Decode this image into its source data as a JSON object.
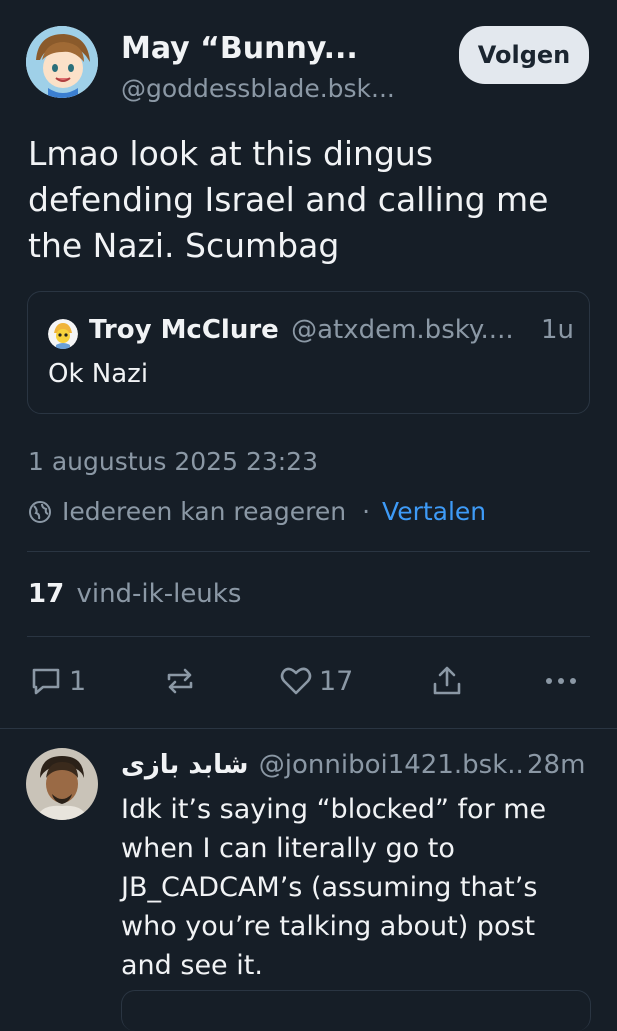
{
  "post": {
    "author_name": "May “Bunny...",
    "author_handle": "@goddessblade.bsk...",
    "follow_label": "Volgen",
    "text": "Lmao look at this dingus defending Israel and calling me the Nazi. Scumbag",
    "quote": {
      "author_name": "Troy McClure",
      "author_handle": "@atxdem.bsky....",
      "time": "1u",
      "text": "Ok Nazi"
    },
    "timestamp": "1 augustus 2025 23:23",
    "reply_setting": "Iedereen kan reageren",
    "separator": "·",
    "translate_label": "Vertalen",
    "likes_count": "17",
    "likes_label": "vind-ik-leuks",
    "actions": {
      "reply_count": "1",
      "like_count": "17"
    }
  },
  "reply": {
    "author_name": "شابد بازی",
    "author_handle": "@jonniboi1421.bsk..",
    "time": "28m",
    "text": "Idk it’s saying “blocked” for me when I can literally go to JB_CADCAM’s (assuming that’s who you’re talking about) post and see it."
  },
  "colors": {
    "background": "#161e27",
    "text": "#f1f3f5",
    "muted": "#8b98a5",
    "link": "#3e9bf7",
    "border": "#2a3542"
  },
  "icons": [
    "reply-icon",
    "repost-icon",
    "heart-icon",
    "share-icon",
    "more-icon",
    "globe-icon"
  ]
}
